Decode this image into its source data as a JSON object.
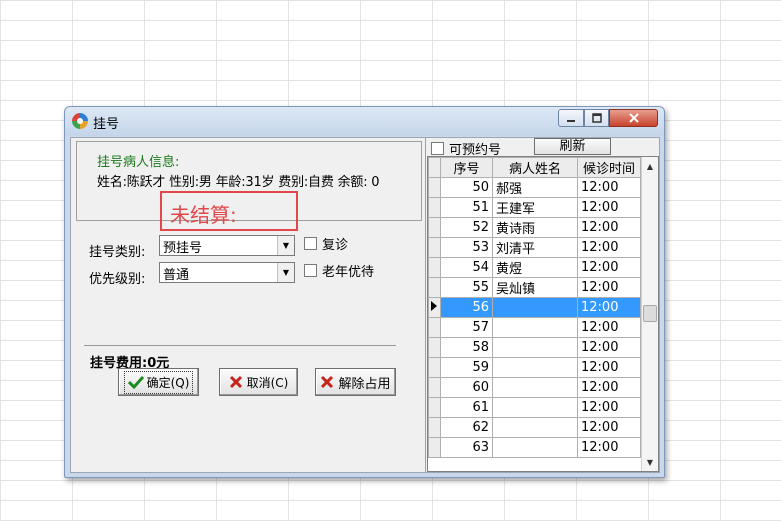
{
  "window": {
    "title": "挂号"
  },
  "patient_info": {
    "title": "挂号病人信息:",
    "details": "姓名:陈跃才 性别:男 年龄:31岁 费别:自费 余额: 0"
  },
  "annotation": {
    "text": "未结算:"
  },
  "form": {
    "reg_type_label": "挂号类别:",
    "reg_type_value": "预挂号",
    "priority_label": "优先级别:",
    "priority_value": "普通",
    "revisit_label": "复诊",
    "elderly_label": "老年优待"
  },
  "fee": {
    "text": "挂号费用:0元"
  },
  "buttons": {
    "ok_label": "确定(Q)",
    "cancel_label": "取消(C)",
    "release_label": "解除占用",
    "refresh_label": "刷新"
  },
  "appointment": {
    "label": "可预约号"
  },
  "grid": {
    "headers": [
      "序号",
      "病人姓名",
      "候诊时间"
    ],
    "rows": [
      {
        "num": "50",
        "name": "郝强",
        "time": "12:00"
      },
      {
        "num": "51",
        "name": "王建军",
        "time": "12:00"
      },
      {
        "num": "52",
        "name": "黄诗雨",
        "time": "12:00"
      },
      {
        "num": "53",
        "name": "刘清平",
        "time": "12:00"
      },
      {
        "num": "54",
        "name": "黄煜",
        "time": "12:00"
      },
      {
        "num": "55",
        "name": "吴灿镇",
        "time": "12:00"
      },
      {
        "num": "56",
        "name": "",
        "time": "12:00"
      },
      {
        "num": "57",
        "name": "",
        "time": "12:00"
      },
      {
        "num": "58",
        "name": "",
        "time": "12:00"
      },
      {
        "num": "59",
        "name": "",
        "time": "12:00"
      },
      {
        "num": "60",
        "name": "",
        "time": "12:00"
      },
      {
        "num": "61",
        "name": "",
        "time": "12:00"
      },
      {
        "num": "62",
        "name": "",
        "time": "12:00"
      },
      {
        "num": "63",
        "name": "",
        "time": "12:00"
      }
    ]
  },
  "colors": {
    "selection": "#3399ff",
    "annotation": "#e0484c",
    "info_title": "#1a7a1a"
  }
}
